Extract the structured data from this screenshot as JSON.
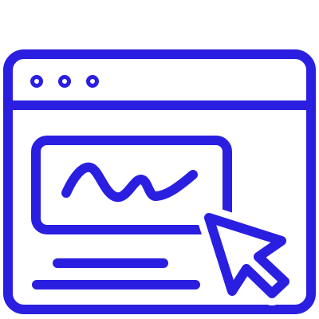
{
  "icon": {
    "name": "e-signature-browser-icon",
    "style": "outline",
    "stroke_color": "#2a1fe0",
    "background_color": "#ffffff",
    "parts": [
      "browser-window-icon",
      "window-dot-icon",
      "signature-box-icon",
      "signature-scribble-icon",
      "text-line-icon",
      "mouse-cursor-icon"
    ]
  }
}
